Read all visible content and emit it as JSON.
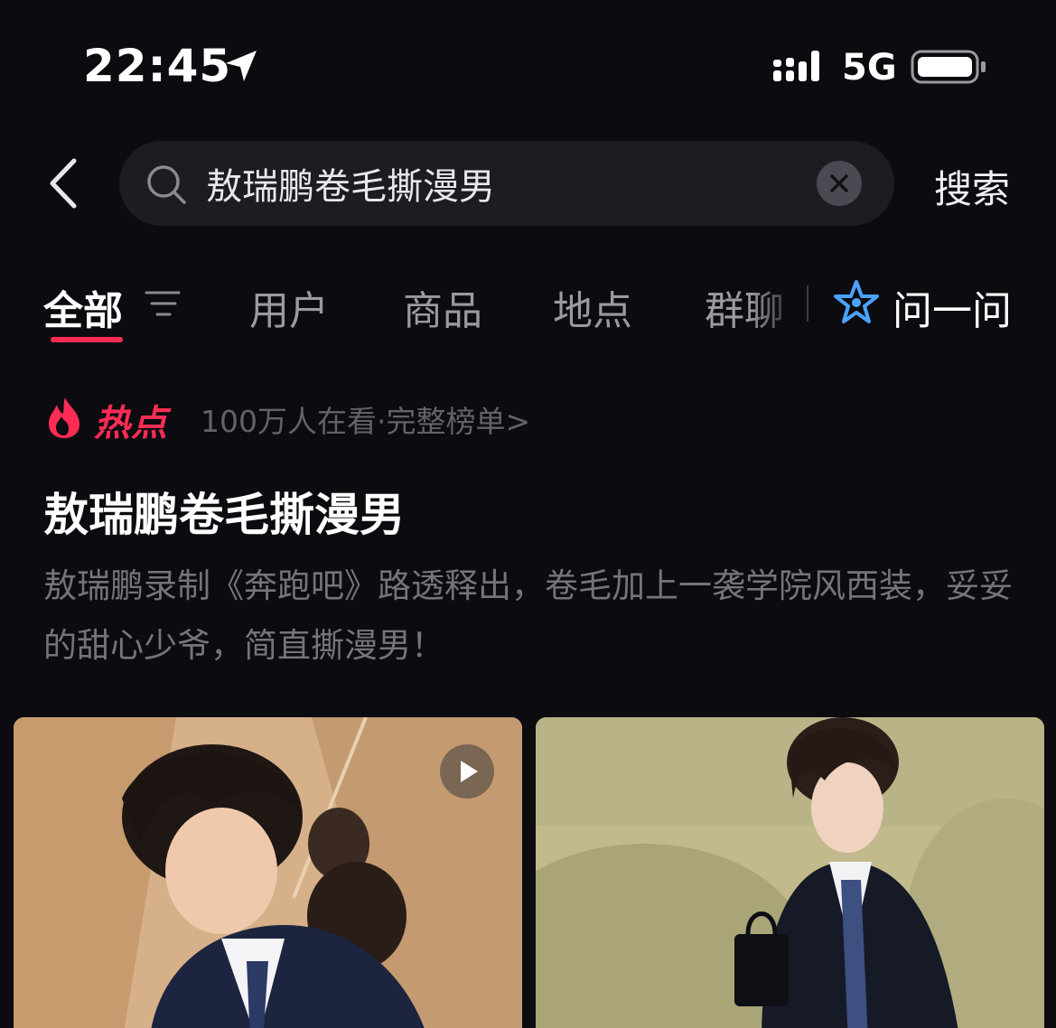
{
  "status_bar": {
    "time": "22:45",
    "network": "5G"
  },
  "search": {
    "query": "敖瑞鹏卷毛撕漫男",
    "submit_label": "搜索"
  },
  "tabs": [
    {
      "label": "全部",
      "active": true
    },
    {
      "label": "用户",
      "active": false
    },
    {
      "label": "商品",
      "active": false
    },
    {
      "label": "地点",
      "active": false
    },
    {
      "label": "群聊",
      "active": false
    }
  ],
  "ask": {
    "label": "问一问"
  },
  "hot": {
    "badge": "热点",
    "meta": "100万人在看·完整榜单>",
    "title": "敖瑞鹏卷毛撕漫男",
    "description": "敖瑞鹏录制《奔跑吧》路透释出，卷毛加上一袭学院风西装，妥妥的甜心少爷，简直撕漫男！"
  },
  "colors": {
    "accent": "#fe2c55",
    "background": "#0b0b10",
    "ask_icon": "#4aa3ff"
  },
  "icons": [
    "back-icon",
    "search-icon",
    "clear-icon",
    "filter-icon",
    "ask-star-icon",
    "fire-icon",
    "play-icon",
    "location-arrow-icon",
    "signal-icon",
    "battery-icon"
  ]
}
